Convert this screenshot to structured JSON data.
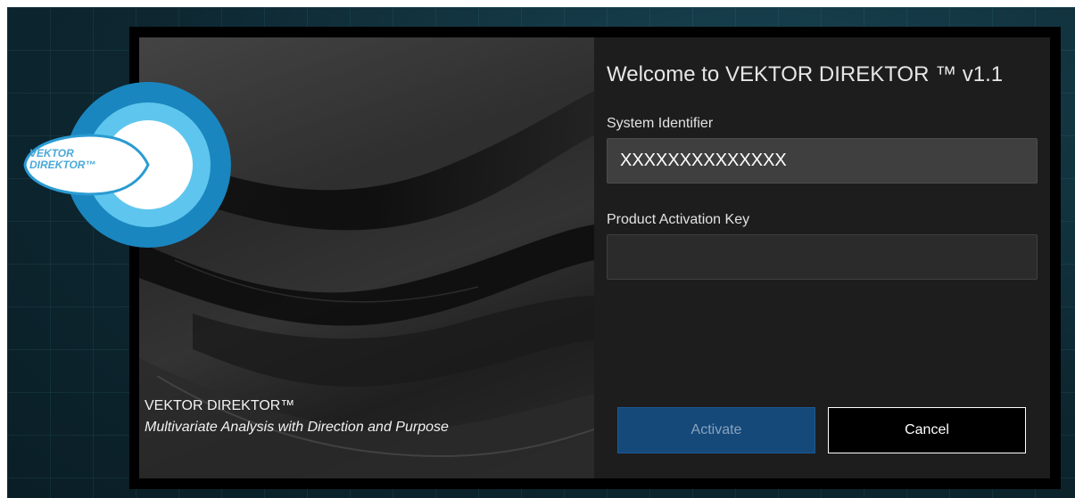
{
  "product": {
    "name": "VEKTOR DIREKTOR™",
    "tagline": "Multivariate Analysis with Direction and Purpose",
    "logo_line1": "VEKTOR",
    "logo_line2": "DIREKTOR™"
  },
  "form": {
    "title": "Welcome to VEKTOR DIREKTOR ™ v1.1",
    "system_identifier_label": "System Identifier",
    "system_identifier_value": "XXXXXXXXXXXXXX",
    "activation_key_label": "Product Activation Key",
    "activation_key_value": ""
  },
  "buttons": {
    "activate": "Activate",
    "cancel": "Cancel"
  },
  "colors": {
    "desktop_bg": "#0f2a33",
    "panel_bg": "#1d1d1d",
    "activate_bg": "#14497a",
    "logo_outer": "#1a86bf",
    "logo_mid": "#5ec6ee"
  },
  "icons": {
    "logo": "vektor-direktor-logo-icon"
  }
}
